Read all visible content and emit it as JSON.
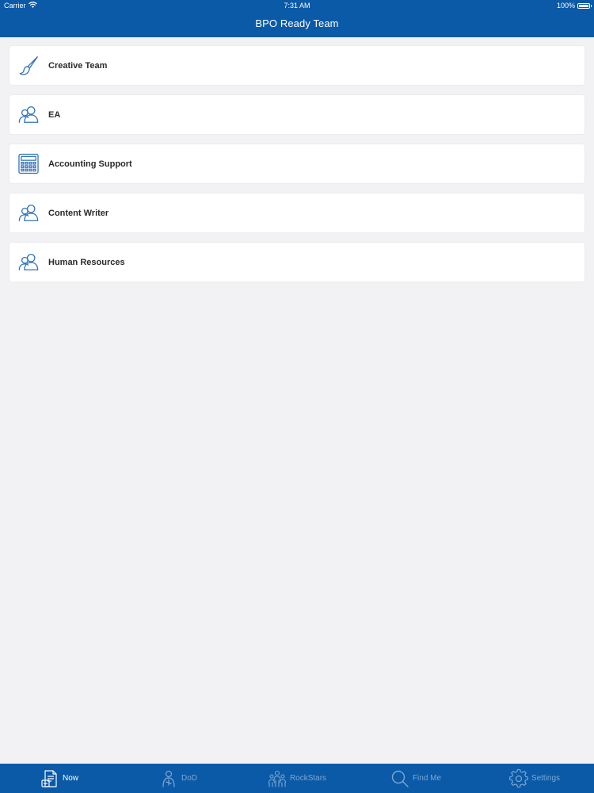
{
  "status_bar": {
    "carrier": "Carrier",
    "time": "7:31 AM",
    "battery": "100%"
  },
  "nav": {
    "title": "BPO Ready Team"
  },
  "teams": [
    {
      "label": "Creative Team",
      "icon": "paintbrush-icon"
    },
    {
      "label": "EA",
      "icon": "people-icon"
    },
    {
      "label": "Accounting Support",
      "icon": "calculator-icon"
    },
    {
      "label": "Content Writer",
      "icon": "people-icon"
    },
    {
      "label": "Human Resources",
      "icon": "people-icon"
    }
  ],
  "tabs": [
    {
      "label": "Now",
      "icon": "document-icon",
      "active": true
    },
    {
      "label": "DoD",
      "icon": "person-icon",
      "active": false
    },
    {
      "label": "RockStars",
      "icon": "group-icon",
      "active": false
    },
    {
      "label": "Find Me",
      "icon": "search-icon",
      "active": false
    },
    {
      "label": "Settings",
      "icon": "gear-icon",
      "active": false
    }
  ],
  "colors": {
    "brand": "#0a5aa8",
    "icon_blue": "#2f73b8",
    "background": "#f2f2f4"
  }
}
